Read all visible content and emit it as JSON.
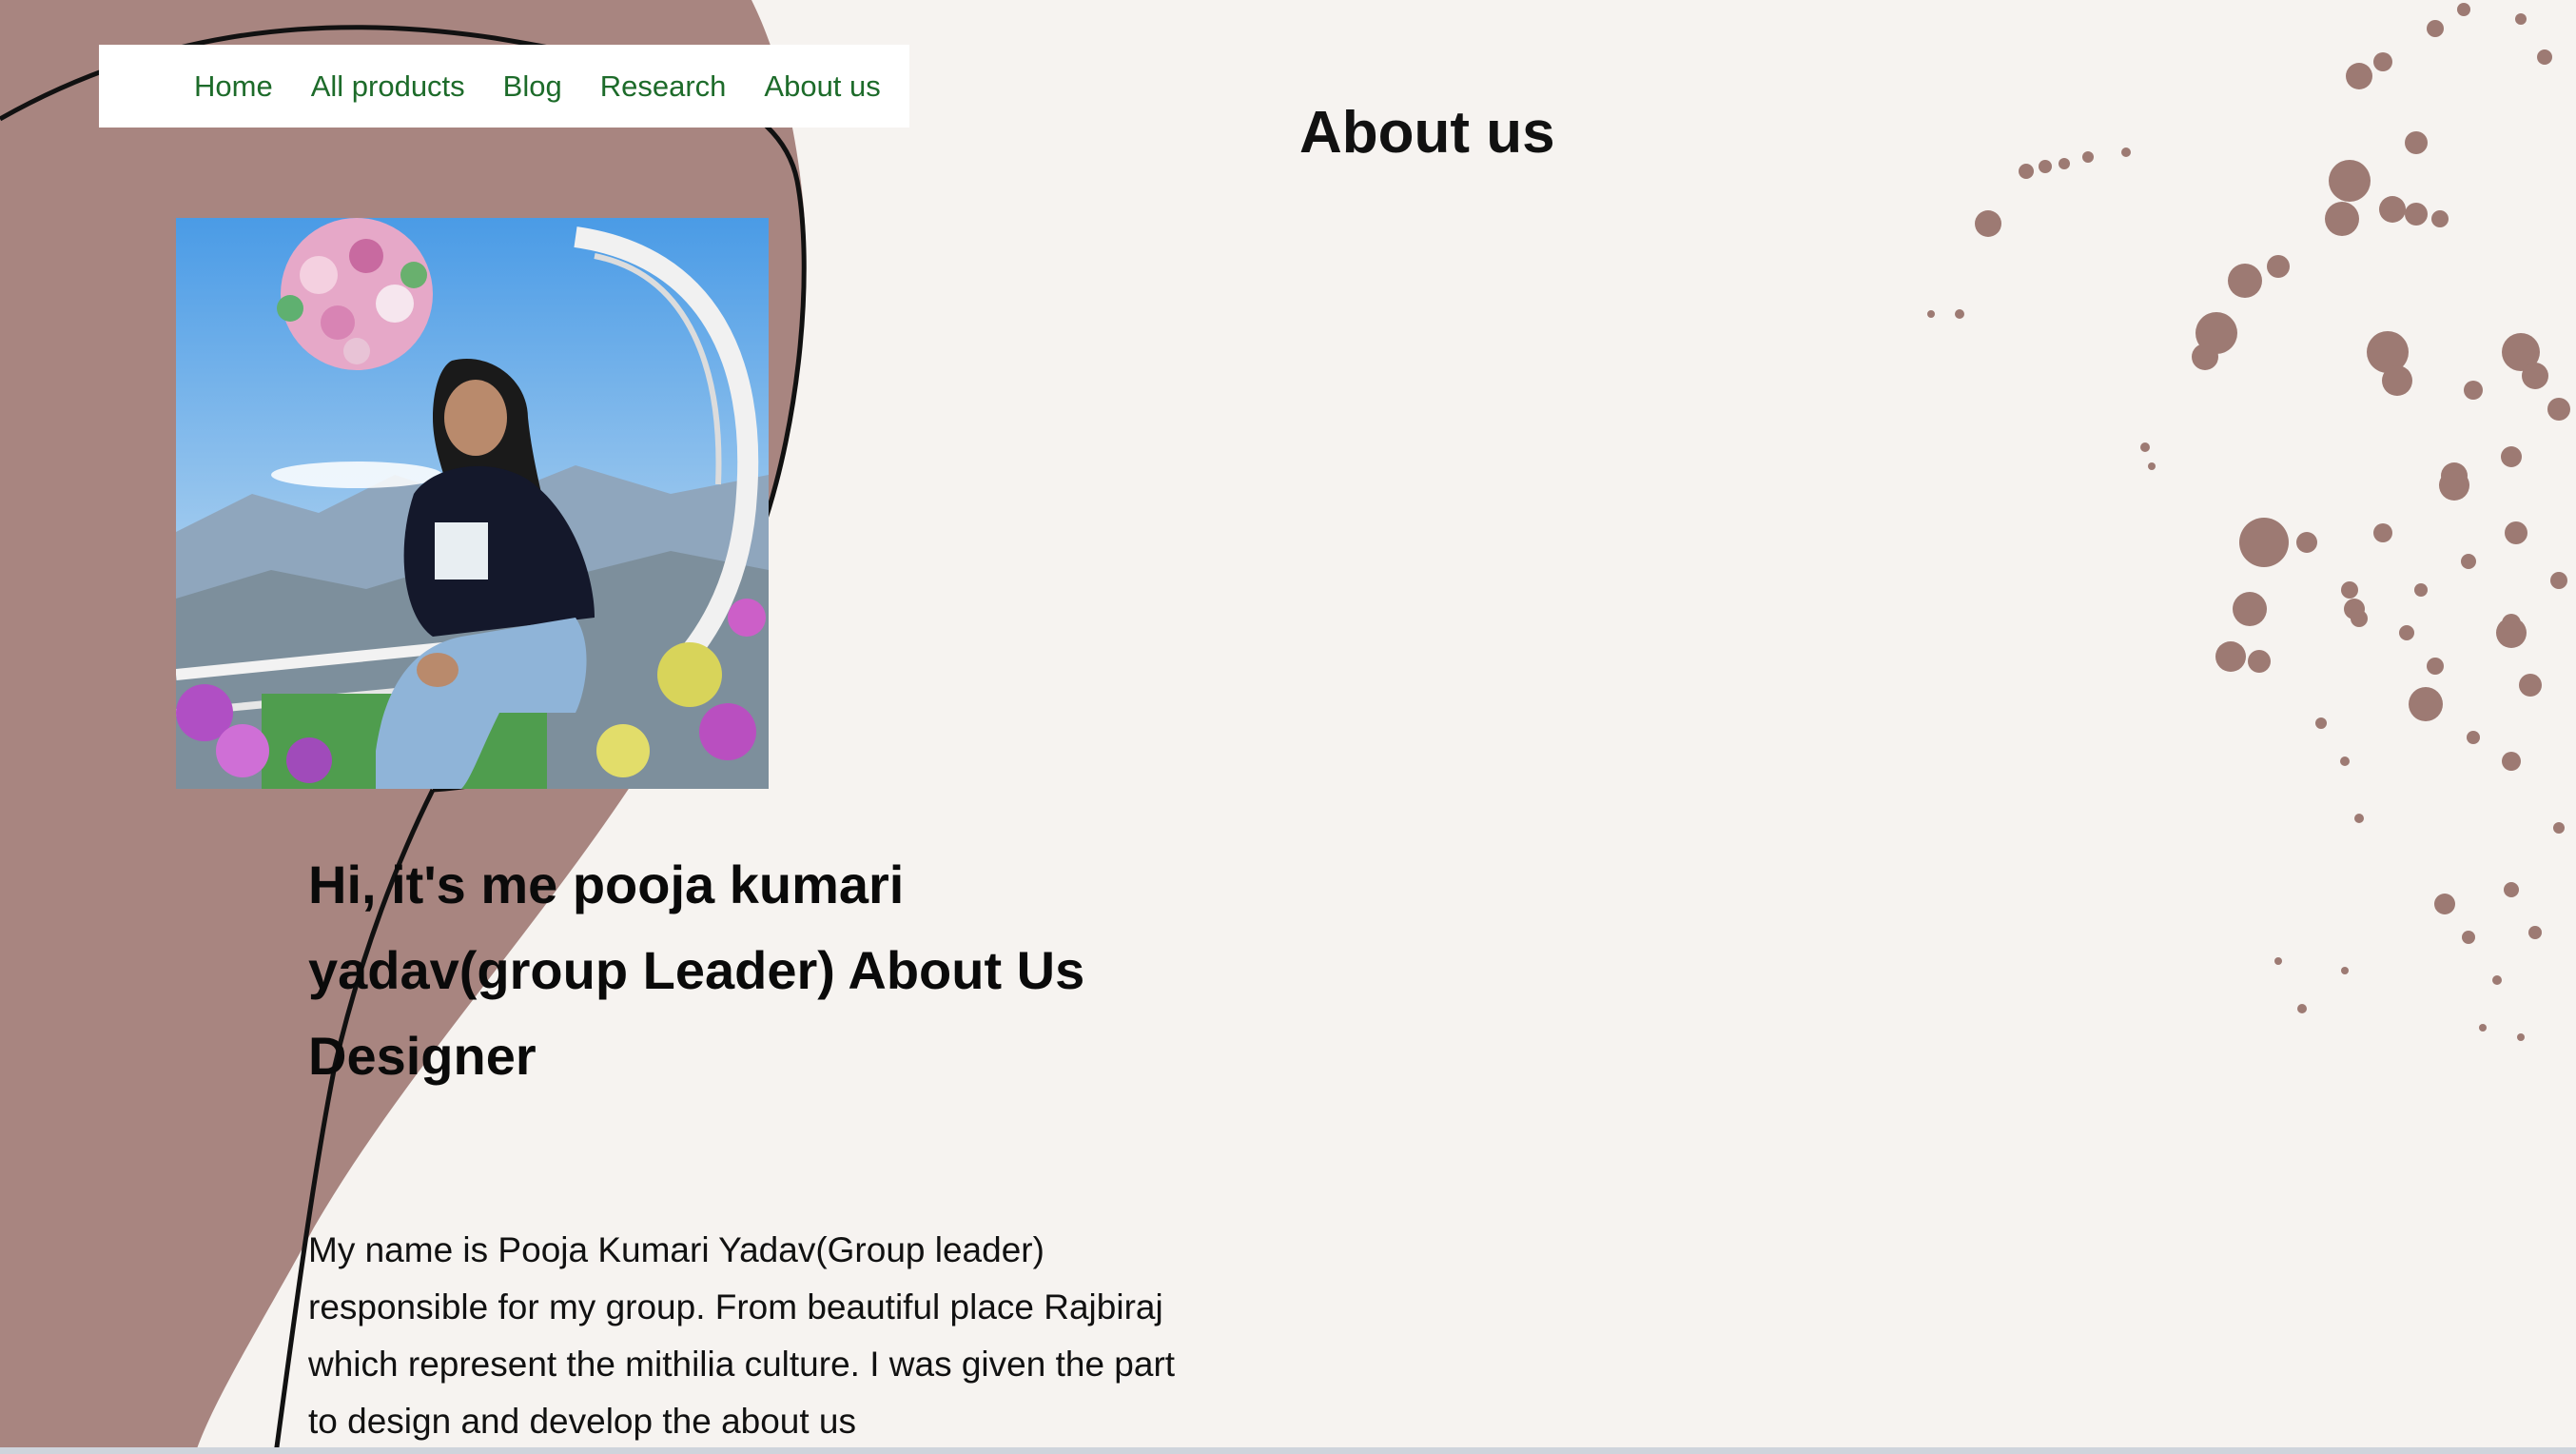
{
  "nav": {
    "items": [
      {
        "label": "Home"
      },
      {
        "label": "All products"
      },
      {
        "label": "Blog"
      },
      {
        "label": "Research"
      },
      {
        "label": "About us"
      }
    ]
  },
  "page_title": "About us",
  "profile": {
    "heading": "Hi, it's me pooja kumari yadav(group Leader) About Us Designer",
    "bio": "My name is Pooja Kumari Yadav(Group leader) responsible for my group. From beautiful place Rajbiraj which represent the mithilia culture. I was given the part to design and develop the about us"
  },
  "colors": {
    "background": "#f6f3f0",
    "accent_mauve": "#a88580",
    "nav_link": "#1d6b2a"
  }
}
